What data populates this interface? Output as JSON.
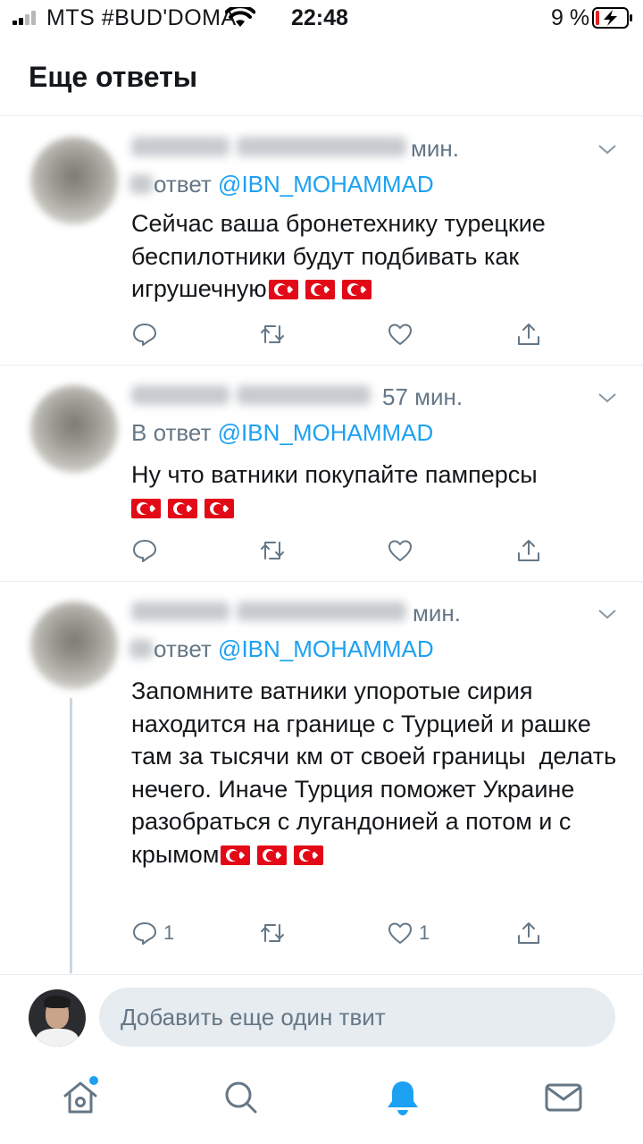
{
  "status_bar": {
    "carrier": "MTS #BUD'DOMA",
    "time": "22:48",
    "battery_percent": "9 %"
  },
  "header": {
    "title": "Еще ответы"
  },
  "tweets": [
    {
      "time": "мин.",
      "reply_prefix": "ответ ",
      "reply_mention": "@IBN_MOHAMMAD",
      "text": "Сейчас ваша бронетехнику турецкие беспилотники будут подбивать как игрушечную",
      "flags": 3,
      "reply_count": "",
      "like_count": ""
    },
    {
      "time": "57 мин.",
      "reply_prefix": "В ответ ",
      "reply_mention": "@IBN_MOHAMMAD",
      "text": "Ну что ватники покупайте памперсы",
      "flags": 3,
      "reply_count": "",
      "like_count": ""
    },
    {
      "time": "мин.",
      "reply_prefix": "ответ ",
      "reply_mention": "@IBN_MOHAMMAD",
      "text": "Запомните ватники упоротые сирия находится на границе с Турцией и рашке там за тысячи км от своей границы  делать нечего. Иначе Турция поможет Украине разобраться с лугандонией а потом и с крымом",
      "flags": 3,
      "reply_count": "1",
      "like_count": "1"
    }
  ],
  "compose": {
    "placeholder": "Добавить еще один твит"
  },
  "tabbar": {
    "items": [
      "home-icon",
      "search-icon",
      "notifications-icon",
      "messages-icon"
    ],
    "active": "notifications-icon"
  },
  "colors": {
    "accent": "#1da1f2",
    "secondary_text": "#657786",
    "divider": "#e6ecf0",
    "flag_red": "#e30a17"
  }
}
